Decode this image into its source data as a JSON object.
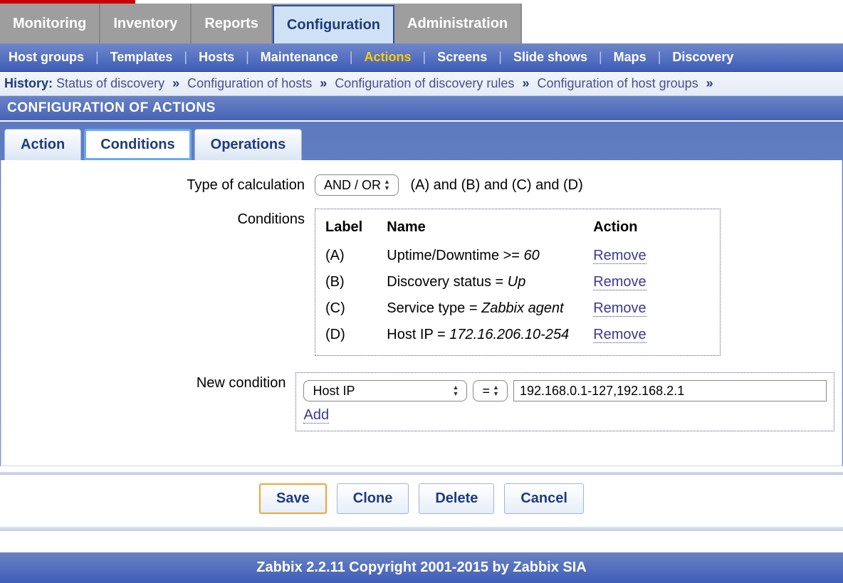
{
  "main_nav": [
    "Monitoring",
    "Inventory",
    "Reports",
    "Configuration",
    "Administration"
  ],
  "main_nav_selected_index": 3,
  "sub_nav": [
    "Host groups",
    "Templates",
    "Hosts",
    "Maintenance",
    "Actions",
    "Screens",
    "Slide shows",
    "Maps",
    "Discovery"
  ],
  "sub_nav_active_index": 4,
  "history": {
    "label": "History:",
    "items": [
      "Status of discovery",
      "Configuration of hosts",
      "Configuration of discovery rules",
      "Configuration of host groups"
    ]
  },
  "page_title": "CONFIGURATION OF ACTIONS",
  "inner_tabs": [
    "Action",
    "Conditions",
    "Operations"
  ],
  "inner_tab_selected_index": 1,
  "calc": {
    "label": "Type of calculation",
    "select_value": "AND / OR",
    "description": "(A) and (B) and (C) and (D)"
  },
  "conditions": {
    "label": "Conditions",
    "headers": {
      "label": "Label",
      "name": "Name",
      "action": "Action"
    },
    "rows": [
      {
        "label": "(A)",
        "name_prefix": "Uptime/Downtime >= ",
        "name_value": "60",
        "action": "Remove"
      },
      {
        "label": "(B)",
        "name_prefix": "Discovery status = ",
        "name_value": "Up",
        "action": "Remove"
      },
      {
        "label": "(C)",
        "name_prefix": "Service type = ",
        "name_value": "Zabbix agent",
        "action": "Remove"
      },
      {
        "label": "(D)",
        "name_prefix": "Host IP = ",
        "name_value": "172.16.206.10-254",
        "action": "Remove"
      }
    ]
  },
  "new_condition": {
    "label": "New condition",
    "type_select": "Host IP",
    "op_select": "=",
    "value": "192.168.0.1-127,192.168.2.1",
    "add_label": "Add"
  },
  "buttons": {
    "save": "Save",
    "clone": "Clone",
    "delete": "Delete",
    "cancel": "Cancel"
  },
  "footer": "Zabbix 2.2.11 Copyright 2001-2015 by Zabbix SIA"
}
